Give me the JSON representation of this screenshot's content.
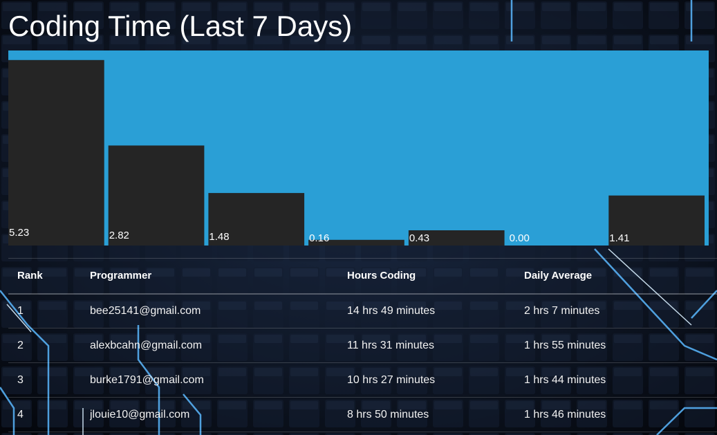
{
  "page": {
    "title": "Coding Time (Last 7 Days)"
  },
  "colors": {
    "chart_background": "#2a9fd6",
    "bar": "#252525",
    "page_background": "#06090f",
    "circuit_glow": "#5ab8ff"
  },
  "chart_data": {
    "type": "bar",
    "title": "Coding Time (Last 7 Days)",
    "xlabel": "",
    "ylabel": "",
    "ylim": [
      0,
      5.5
    ],
    "grid": false,
    "legend": "none",
    "categories": [
      "",
      "",
      "",
      "",
      "",
      "",
      ""
    ],
    "values": [
      5.23,
      2.82,
      1.48,
      0.16,
      0.43,
      0.0,
      1.41
    ],
    "labels": [
      "5.23",
      "2.82",
      "1.48",
      "0.16",
      "0.43",
      "0.00",
      "1.41"
    ]
  },
  "leaderboard": {
    "headers": {
      "rank": "Rank",
      "programmer": "Programmer",
      "hours": "Hours Coding",
      "average": "Daily Average"
    },
    "rows": [
      {
        "rank": "1",
        "programmer": "bee25141@gmail.com",
        "hours": "14 hrs 49 minutes",
        "average": "2 hrs 7 minutes"
      },
      {
        "rank": "2",
        "programmer": "alexbcahn@gmail.com",
        "hours": "11 hrs 31 minutes",
        "average": "1 hrs 55 minutes"
      },
      {
        "rank": "3",
        "programmer": "burke1791@gmail.com",
        "hours": "10 hrs 27 minutes",
        "average": "1 hrs 44 minutes"
      },
      {
        "rank": "4",
        "programmer": "jlouie10@gmail.com",
        "hours": "8 hrs 50 minutes",
        "average": "1 hrs 46 minutes"
      }
    ]
  }
}
